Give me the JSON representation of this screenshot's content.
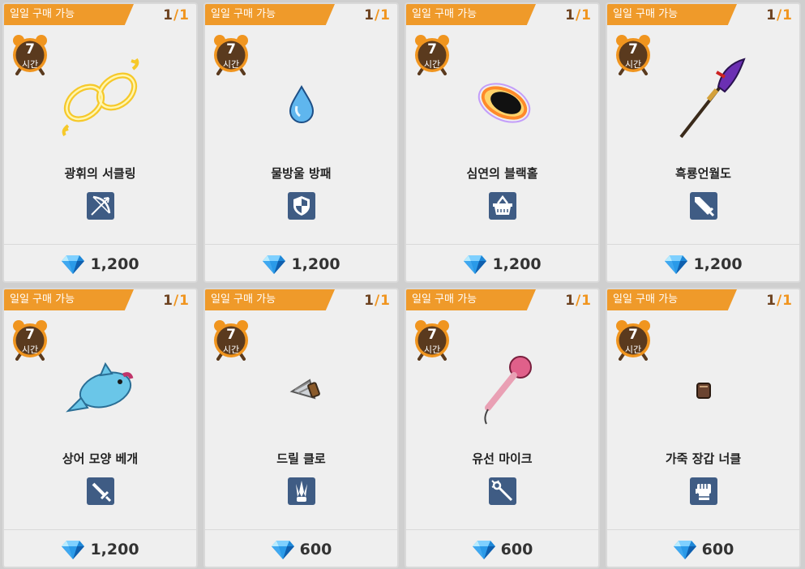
{
  "cards": [
    {
      "badge": "일일 구매 가능",
      "count_current": "1",
      "count_sep": "/",
      "count_max": "1",
      "timer_value": "7",
      "timer_unit": "시간",
      "item_name": "광휘의 서클링",
      "item_icon": "golden-infinity-ring-icon",
      "type_icon": "bow-icon",
      "price": "1,200",
      "currency_icon": "blue-diamond-icon"
    },
    {
      "badge": "일일 구매 가능",
      "count_current": "1",
      "count_sep": "/",
      "count_max": "1",
      "timer_value": "7",
      "timer_unit": "시간",
      "item_name": "물방울 방패",
      "item_icon": "water-drop-icon",
      "type_icon": "shield-icon",
      "price": "1,200",
      "currency_icon": "blue-diamond-icon"
    },
    {
      "badge": "일일 구매 가능",
      "count_current": "1",
      "count_sep": "/",
      "count_max": "1",
      "timer_value": "7",
      "timer_unit": "시간",
      "item_name": "심연의 블랙홀",
      "item_icon": "black-hole-icon",
      "type_icon": "basket-icon",
      "price": "1,200",
      "currency_icon": "blue-diamond-icon"
    },
    {
      "badge": "일일 구매 가능",
      "count_current": "1",
      "count_sep": "/",
      "count_max": "1",
      "timer_value": "7",
      "timer_unit": "시간",
      "item_name": "흑룡언월도",
      "item_icon": "glaive-icon",
      "type_icon": "greatsword-icon",
      "price": "1,200",
      "currency_icon": "blue-diamond-icon"
    },
    {
      "badge": "일일 구매 가능",
      "count_current": "1",
      "count_sep": "/",
      "count_max": "1",
      "timer_value": "7",
      "timer_unit": "시간",
      "item_name": "상어 모양 베개",
      "item_icon": "shark-pillow-icon",
      "type_icon": "sword-icon",
      "price": "1,200",
      "currency_icon": "blue-diamond-icon"
    },
    {
      "badge": "일일 구매 가능",
      "count_current": "1",
      "count_sep": "/",
      "count_max": "1",
      "timer_value": "7",
      "timer_unit": "시간",
      "item_name": "드릴 클로",
      "item_icon": "drill-claw-icon",
      "type_icon": "claw-icon",
      "price": "600",
      "currency_icon": "blue-diamond-icon"
    },
    {
      "badge": "일일 구매 가능",
      "count_current": "1",
      "count_sep": "/",
      "count_max": "1",
      "timer_value": "7",
      "timer_unit": "시간",
      "item_name": "유선 마이크",
      "item_icon": "microphone-icon",
      "type_icon": "staff-icon",
      "price": "600",
      "currency_icon": "blue-diamond-icon"
    },
    {
      "badge": "일일 구매 가능",
      "count_current": "1",
      "count_sep": "/",
      "count_max": "1",
      "timer_value": "7",
      "timer_unit": "시간",
      "item_name": "가죽 장갑 너클",
      "item_icon": "leather-knuckle-icon",
      "type_icon": "fist-icon",
      "price": "600",
      "currency_icon": "blue-diamond-icon"
    }
  ],
  "colors": {
    "badge": "#ef9a2a",
    "count_current": "#6e4321",
    "count_max": "#f0951f",
    "type_icon_bg": "#3f5c84",
    "timer": "#5a3a1e",
    "timer_ring": "#f0951f"
  }
}
